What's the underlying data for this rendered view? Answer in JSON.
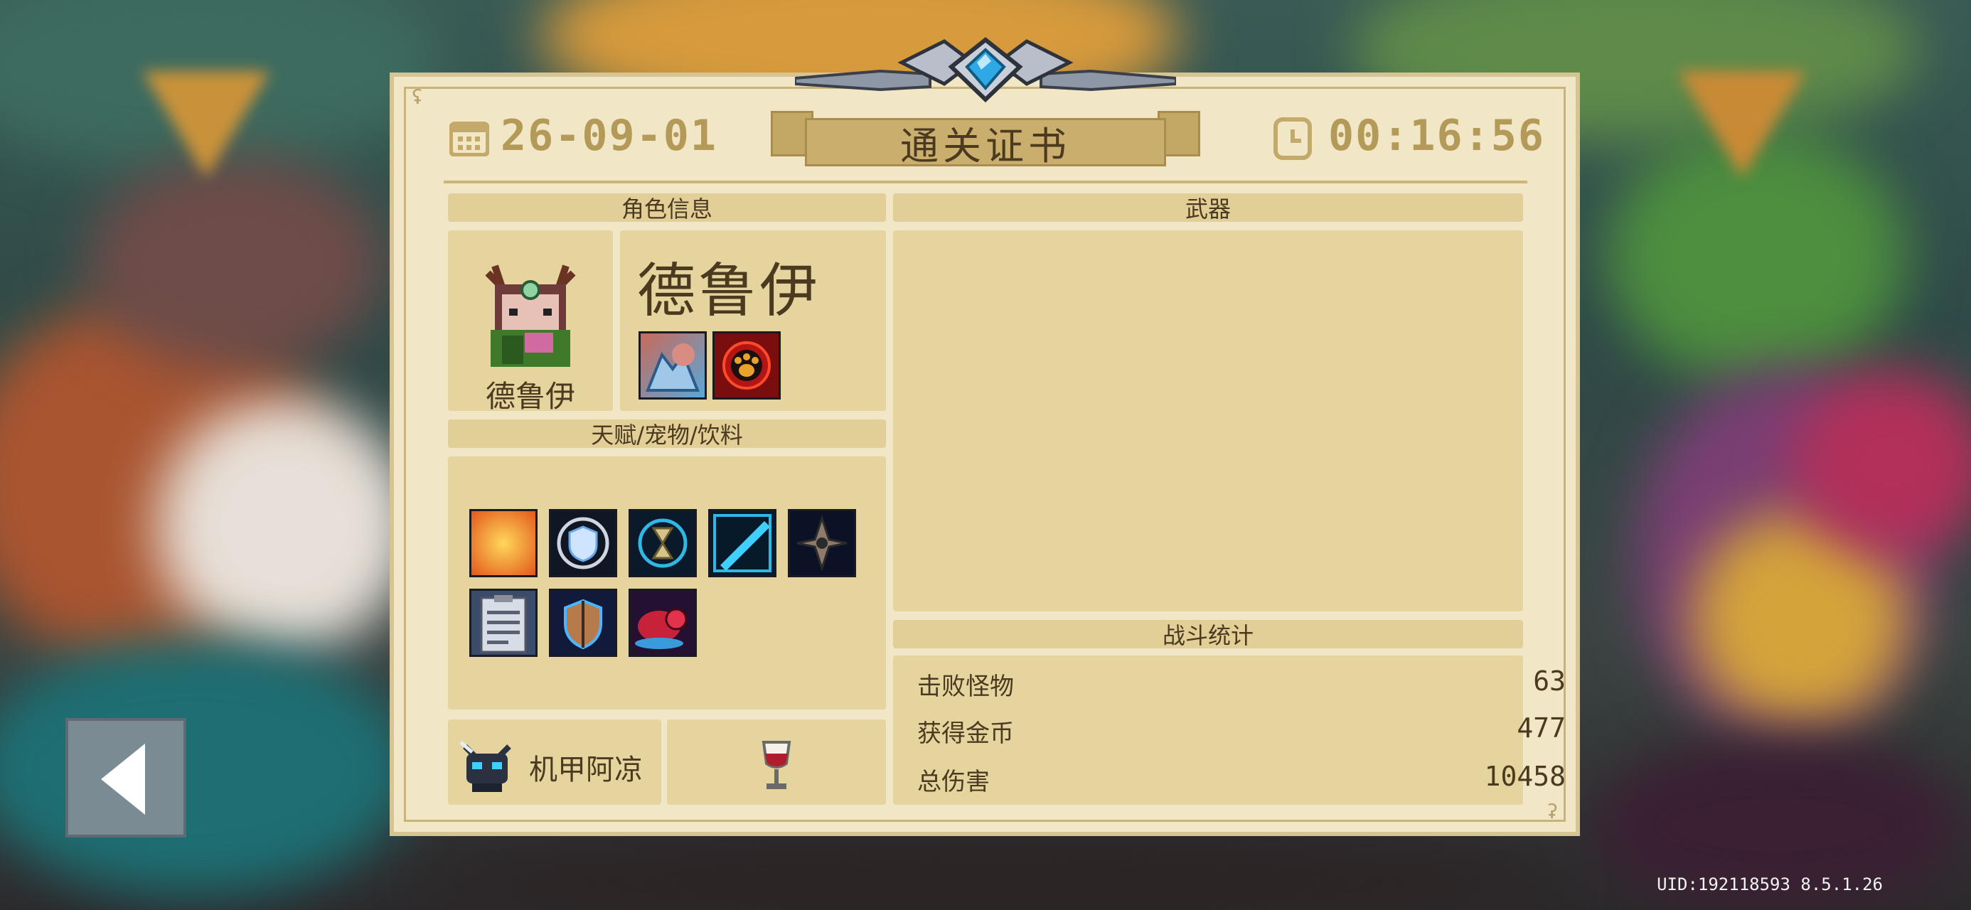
{
  "certificate": {
    "title": "通关证书",
    "date": "26-09-01",
    "time": "00:16:56"
  },
  "character": {
    "section_title": "角色信息",
    "name_large": "德鲁伊",
    "name_small": "德鲁伊",
    "skins": [
      "wolf-companion-icon",
      "paw-emblem-icon"
    ]
  },
  "talents": {
    "section_title": "天赋/宠物/饮料",
    "items": [
      "flame-cat-icon",
      "shield-icon",
      "hourglass-icon",
      "slash-icon",
      "shuriken-icon",
      "clipboard-icon",
      "lightning-shield-icon",
      "red-worm-icon"
    ]
  },
  "pet": {
    "name": "机甲阿凉",
    "icon": "mech-cat-icon"
  },
  "drink": {
    "icon": "wine-glass-icon"
  },
  "weapons": {
    "section_title": "武器"
  },
  "battle_stats": {
    "section_title": "战斗统计",
    "rows": [
      {
        "label": "击败怪物",
        "value": "63"
      },
      {
        "label": "获得金币",
        "value": "477"
      },
      {
        "label": "总伤害",
        "value": "10458"
      }
    ]
  },
  "footer": {
    "uid": "UID:192118593 8.5.1.26"
  },
  "colors": {
    "panel": "#f1e6c6",
    "section": "#e6d49f",
    "header_text": "#b49a58",
    "crest_gem": "#2fa8e6"
  }
}
